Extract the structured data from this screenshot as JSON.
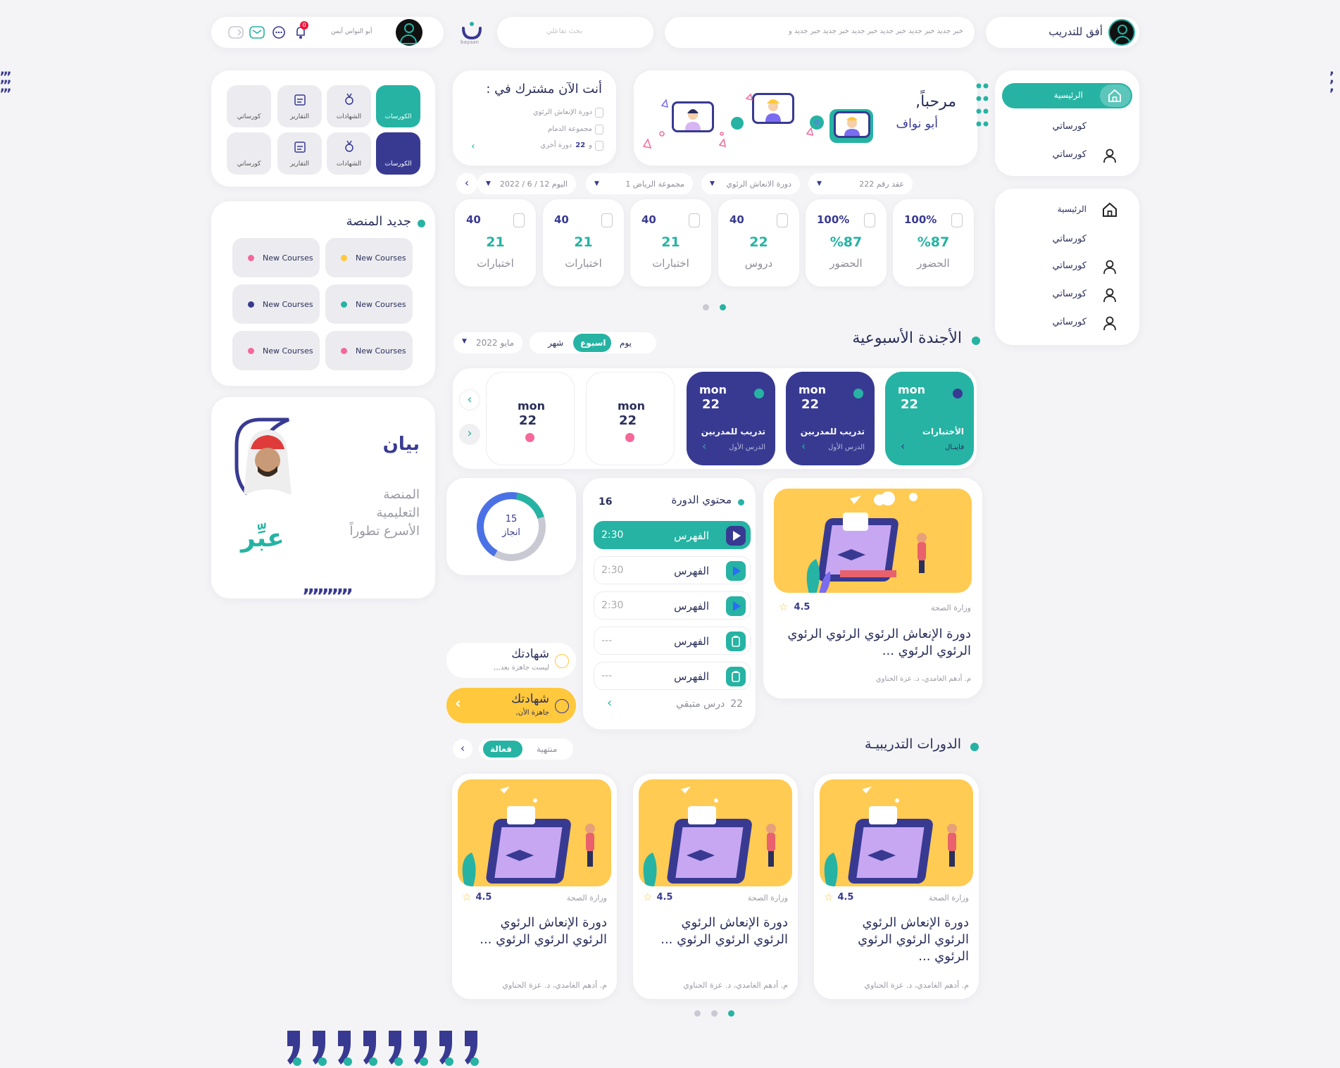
{
  "topbar": {
    "brand": "أفق للتدريب",
    "ticker": "خبر جديد خبر جديد خبر جديد خبر جديد خبر جديد خبر جديد و",
    "search_placeholder": "بحث تفاعلي",
    "logo_text": "bayaan",
    "user_name": "أبو النواس أيمن",
    "notif_count": "0"
  },
  "sidebar": {
    "home_active": "الرئيسية",
    "items_a": [
      "كورساتي",
      "كورساتي"
    ],
    "home2": "الرئيسية",
    "items_b": [
      "كورساتي",
      "كورساتي",
      "كورساتي",
      "كورساتي"
    ]
  },
  "welcome": {
    "title": "مرحباً,",
    "name": "أبو نواف"
  },
  "subscribed": {
    "title": "أنت الآن مشترك في :",
    "items": [
      "دورة الإنعاش الرئوي",
      "مجموعة الدمام"
    ],
    "more_count": "22",
    "more_label": "و",
    "more_suffix": "دورة أخري"
  },
  "filters": {
    "contract": "عقد رقم 222",
    "course": "دورة الانعاش الرئوي",
    "group": "مجموعة الرياض 1",
    "date": "اليوم 12 / 6 / 2022"
  },
  "stats": [
    {
      "top": "100%",
      "big": "%87",
      "label": "الحضور"
    },
    {
      "top": "100%",
      "big": "%87",
      "label": "الحضور"
    },
    {
      "top": "40",
      "big": "22",
      "label": "دروس"
    },
    {
      "top": "40",
      "big": "21",
      "label": "اختبارات"
    },
    {
      "top": "40",
      "big": "21",
      "label": "اختبارات"
    },
    {
      "top": "40",
      "big": "21",
      "label": "اختبارات"
    }
  ],
  "agenda": {
    "title": "الأجندة الأسبوعية",
    "tabs": [
      "يوم",
      "اسبوع",
      "شهر"
    ],
    "active_tab": "اسبوع",
    "month": "مايو 2022",
    "days": [
      {
        "name": "mon",
        "num": "22",
        "title": "الأختبارات",
        "sub": "فاينـال"
      },
      {
        "name": "mon",
        "num": "22",
        "title": "تدريب للمدربين",
        "sub": "الدرس الأول"
      },
      {
        "name": "mon",
        "num": "22",
        "title": "تدريب للمدربين",
        "sub": "الدرس الأول"
      },
      {
        "name": "mon",
        "num": "22"
      },
      {
        "name": "mon",
        "num": "22"
      }
    ]
  },
  "featured": {
    "org": "وزارة الصحة",
    "rating": "4.5",
    "title": "دورة الإنعاش الرئوي الرئوي الرئوي الرئوي الرئوي ...",
    "authors": "م. أدهم الغامدي، د. عزة الحناوي"
  },
  "content": {
    "title": "محتوي الدورة",
    "count": "16",
    "lessons": [
      {
        "name": "الفهرس",
        "time": "2:30",
        "kind": "video",
        "active": true
      },
      {
        "name": "الفهرس",
        "time": "2:30",
        "kind": "video"
      },
      {
        "name": "الفهرس",
        "time": "2:30",
        "kind": "video"
      },
      {
        "name": "الفهرس",
        "time": "---",
        "kind": "task"
      },
      {
        "name": "الفهرس",
        "time": "---",
        "kind": "task"
      }
    ],
    "remaining_count": "22",
    "remaining_label": "درس متبقي"
  },
  "progress": {
    "value": "15",
    "label": "انجاز",
    "percent": 0.7
  },
  "certs": [
    {
      "title": "شهادتك",
      "sub": "ليست جاهزة بعد,,,"
    },
    {
      "title": "شهادتك",
      "sub": "جاهزة الأن,"
    }
  ],
  "quick": [
    [
      "الكورسات",
      "الشهادات",
      "التقارير",
      "كورساتي"
    ],
    [
      "الكورسات",
      "الشهادات",
      "التقارير",
      "كورساتي"
    ]
  ],
  "news": {
    "title": "جديد المنصة",
    "items": [
      {
        "label": "New Courses",
        "color": "#ffc83d"
      },
      {
        "label": "New Courses",
        "color": "#f5689a"
      },
      {
        "label": "New Courses",
        "color": "#26b3a3"
      },
      {
        "label": "New Courses",
        "color": "#383a92"
      },
      {
        "label": "New Courses",
        "color": "#f5689a"
      },
      {
        "label": "New Courses",
        "color": "#f5689a"
      }
    ]
  },
  "promo": {
    "brand": "بيان",
    "line1": "المنصة",
    "line2": "التعليمية",
    "line3": "الأسرع تطوراً",
    "slogan": "عبِّر"
  },
  "courses": {
    "title": "الدورات التدريبيـة",
    "tabs": [
      "فعالة",
      "منتهية"
    ],
    "items": [
      {
        "org": "وزارة الصحة",
        "rating": "4.5",
        "title": "دورة الإنعاش الرئوي الرئوي الرئوي الرئوي الرئوي ...",
        "authors": "م. أدهم الغامدي، د. عزة الحناوي"
      },
      {
        "org": "وزارة الصحة",
        "rating": "4.5",
        "title": "دورة الإنعاش الرئوي الرئوي الرئوي الرئوي ...",
        "authors": "م. أدهم الغامدي، د. عزة الحناوي"
      },
      {
        "org": "وزارة الصحة",
        "rating": "4.5",
        "title": "دورة الإنعاش الرئوي الرئوي الرئوي الرئوي ...",
        "authors": "م. أدهم الغامدي، د. عزة الحناوي"
      }
    ]
  },
  "colors": {
    "teal": "#26b3a3",
    "navy": "#383a92",
    "yellow": "#ffc83d",
    "pink": "#f5689a"
  }
}
